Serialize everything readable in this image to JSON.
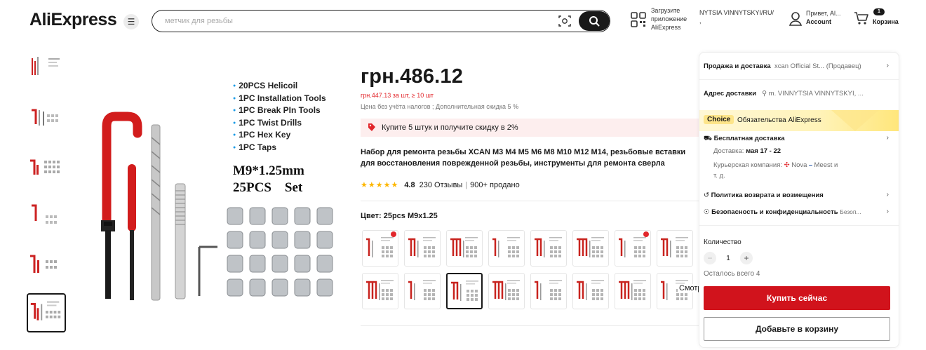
{
  "header": {
    "logo": "AliExpress",
    "search_placeholder": "метчик для резьбы",
    "app_line1": "Загрузите",
    "app_line2": "приложение",
    "app_line3": "AliExpress",
    "ship_to": "NYTSIA VINNYTSKYI/RU/",
    "ship_to_sub": ",",
    "greeting": "Привет, Al...",
    "account": "Account",
    "cart_count": "1",
    "cart": "Корзина"
  },
  "gallery": {
    "thumbnail_count": 6,
    "active_index": 5,
    "specs": [
      "20PCS Helicoil",
      "1PC Installation Tools",
      "1PC Break PIn Tools",
      "1PC Twist Drills",
      "1PC Hex Key",
      "1PC Taps"
    ],
    "size_text": "M9*1.25mm\n25PCS    Set"
  },
  "product": {
    "price": "грн.486.12",
    "bulk_price": "грн.447.13 за шт, ≥ 10 шт",
    "price_note": "Цена без учёта налогов ; Дополнительная скидка 5 %",
    "promo": "Купите 5 штук и получите скидку в 2%",
    "title_line1": "Набор для ремонта резьбы XCAN M3 M4 M5 M6 M8 M10 M12 M14, резьбовые вставки",
    "title_line2": "для восстановления поврежденной резьбы, инструменты для ремонта сверла",
    "rating": "4.8",
    "reviews": "230 Отзывы",
    "sold": "900+ продано",
    "color_label": "Цвет: 25pcs M9x1.25",
    "variants_row1_hot": [
      0,
      6
    ],
    "variants_active_row2": 2,
    "more": "Смотреть"
  },
  "panel": {
    "seller_label": "Продажа и доставка",
    "seller_value": "xcan Official St... (Продавец)",
    "address_label": "Адрес доставки",
    "address_value": "m. VINNYTSIA VINNYTSKYI, ...",
    "choice_badge": "Choice",
    "choice_text": "Обязательства AliExpress",
    "free_shipping": "Бесплатная доставка",
    "delivery_label": "Доставка:",
    "delivery_value": "мая 17 - 22",
    "courier_label": "Курьерская компания:",
    "courier_nova": "Nova",
    "courier_meest": "Meest",
    "courier_more": "и",
    "courier_more2": "т. д.",
    "return_policy": "Политика возврата и возмещения",
    "security": "Безопасность и конфиденциальность",
    "security_sub": "Безоп...",
    "qty_label": "Количество",
    "qty_value": "1",
    "stock": "Осталось всего 4",
    "buy_now": "Купить сейчас",
    "add_to_cart": "Добавьте в корзину"
  },
  "colors": {
    "brand_red": "#d1131c",
    "price_red": "#e2272c",
    "star": "#fdb600",
    "choice_yellow": "#fde58a"
  }
}
